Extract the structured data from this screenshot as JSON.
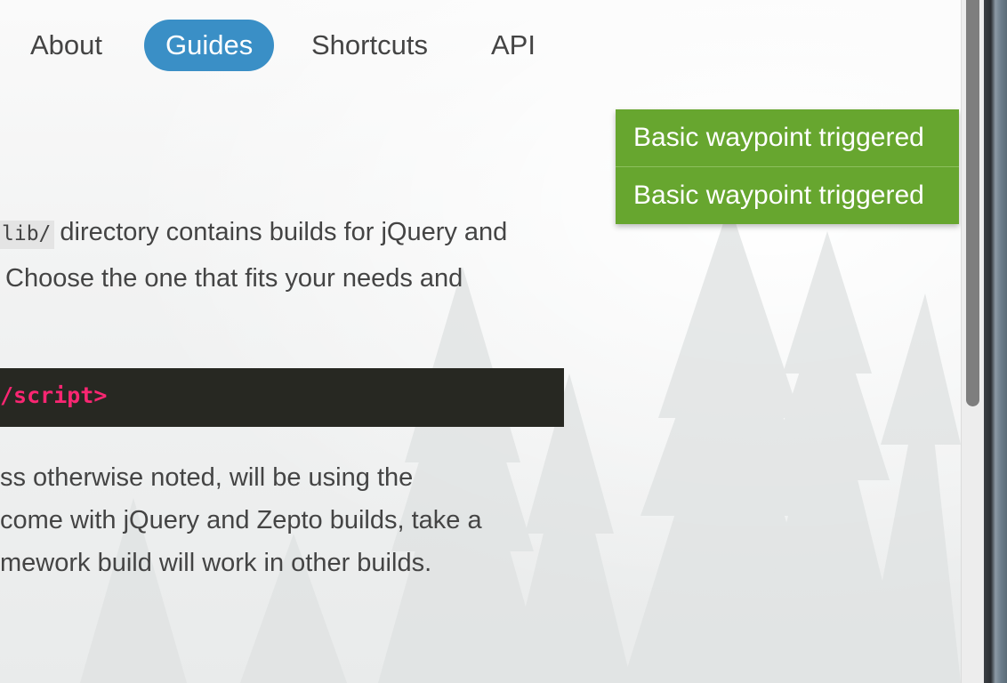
{
  "nav": {
    "items": [
      {
        "label": "About"
      },
      {
        "label": "Guides"
      },
      {
        "label": "Shortcuts"
      },
      {
        "label": "API"
      }
    ],
    "active_index": 1
  },
  "content": {
    "para1": {
      "code": "lib/",
      "line1": "directory contains builds for jQuery and",
      "line2": "Choose the one that fits your needs and"
    },
    "code_block": "/script>",
    "para2": {
      "line1": "ss otherwise noted, will be using the",
      "line2": "come with jQuery and Zepto builds, take a",
      "line3": "mework build will work in other builds."
    }
  },
  "notifications": [
    {
      "text": "Basic waypoint triggered"
    },
    {
      "text": "Basic waypoint triggered"
    }
  ],
  "colors": {
    "nav_active_bg": "#3a8fc6",
    "notification_bg": "#67a62f",
    "code_bg": "#272822",
    "code_text": "#f92672",
    "body_text": "#444444"
  }
}
